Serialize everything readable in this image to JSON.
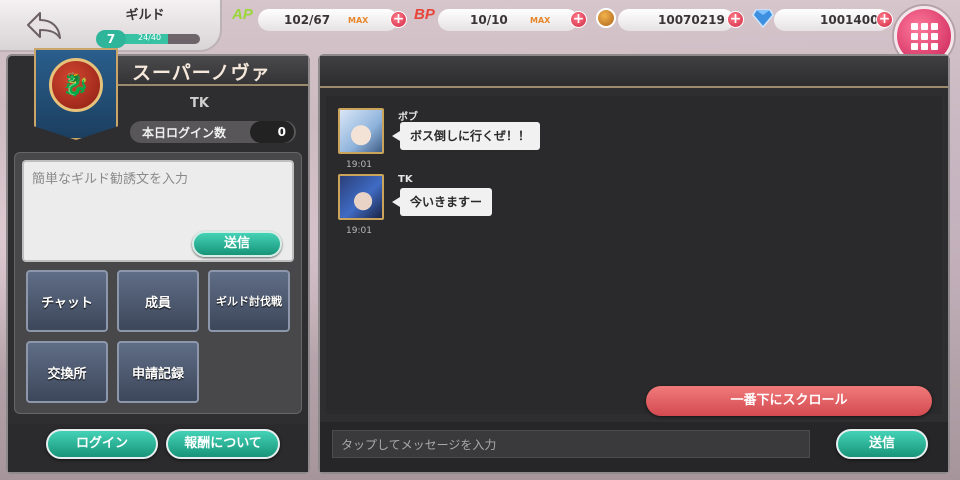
{
  "header": {
    "title": "ギルド",
    "level": "7",
    "level_progress_text": "24/40",
    "level_progress": 0.6,
    "ap_label": "AP",
    "ap_value": "102/67",
    "ap_max": "MAX",
    "bp_label": "BP",
    "bp_value": "10/10",
    "bp_max": "MAX",
    "coins": "10070219",
    "gems": "1001400",
    "back_icon": "back-arrow-icon",
    "menu_icon": "grid-menu-icon"
  },
  "guild": {
    "name": "スーパーノヴァ",
    "leader": "TK",
    "login_count_label": "本日ログイン数",
    "login_count_value": "0",
    "recruit_placeholder": "簡単なギルド勧誘文を入力",
    "recruit_send": "送信"
  },
  "menu": {
    "chat": "チャット",
    "members": "成員",
    "guild_battle": "ギルド討伐戦",
    "exchange": "交換所",
    "application_record": "申請記録",
    "login": "ログイン",
    "rewards": "報酬について"
  },
  "chat": {
    "messages": [
      {
        "sender": "ボブ",
        "text": "ボス倒しに行くぜ！！",
        "time": "19:01"
      },
      {
        "sender": "TK",
        "text": "今いきますー",
        "time": "19:01"
      }
    ],
    "scroll_bottom": "一番下にスクロール",
    "input_placeholder": "タップしてメッセージを入力",
    "send": "送信"
  },
  "colors": {
    "accent_teal": "#2fb59a",
    "accent_red": "#d34a50",
    "panel": "#2e2e30"
  }
}
